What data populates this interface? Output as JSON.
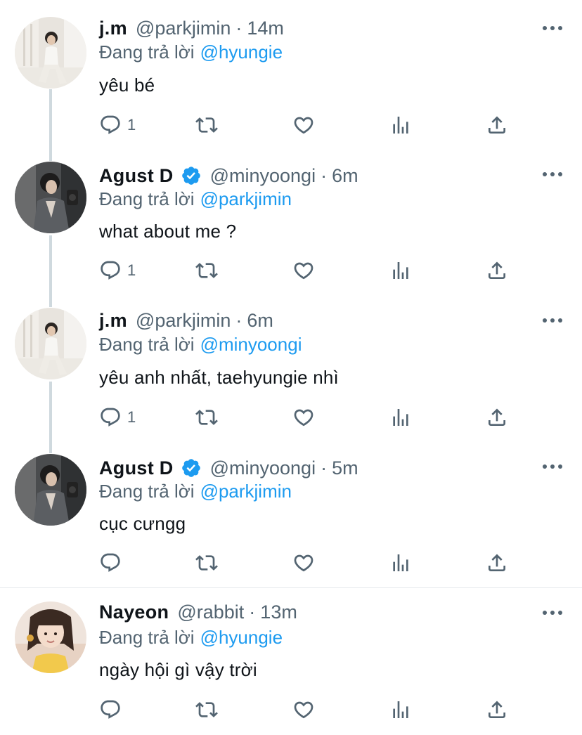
{
  "colors": {
    "link": "#1d9bf0",
    "muted": "#536471",
    "text": "#0f1419",
    "verified": "#1d9bf0",
    "thread_line": "#cfd9de"
  },
  "tweets": [
    {
      "name": "j.m",
      "handle": "@parkjimin",
      "dot": "·",
      "time": "14m",
      "replying_label": "Đang trả lời",
      "replying_to": "@hyungie",
      "text": "yêu bé",
      "reply_count": "1",
      "verified": false,
      "avatar": "jimin-photo"
    },
    {
      "name": "Agust D",
      "handle": "@minyoongi",
      "dot": "·",
      "time": "6m",
      "replying_label": "Đang trả lời",
      "replying_to": "@parkjimin",
      "text": "what about me ?",
      "reply_count": "1",
      "verified": true,
      "avatar": "yoongi-photo"
    },
    {
      "name": "j.m",
      "handle": "@parkjimin",
      "dot": "·",
      "time": "6m",
      "replying_label": "Đang trả lời",
      "replying_to": "@minyoongi",
      "text": "yêu anh nhất, taehyungie nhì",
      "reply_count": "1",
      "verified": false,
      "avatar": "jimin-photo"
    },
    {
      "name": "Agust D",
      "handle": "@minyoongi",
      "dot": "·",
      "time": "5m",
      "replying_label": "Đang trả lời",
      "replying_to": "@parkjimin",
      "text": "cục cưngg",
      "reply_count": "",
      "verified": true,
      "avatar": "yoongi-photo"
    },
    {
      "name": "Nayeon",
      "handle": "@rabbit",
      "dot": "·",
      "time": "13m",
      "replying_label": "Đang trả lời",
      "replying_to": "@hyungie",
      "text": "ngày hội gì vậy trời",
      "reply_count": "",
      "verified": false,
      "avatar": "nayeon-photo"
    }
  ],
  "icons": {
    "reply": "reply-icon",
    "retweet": "retweet-icon",
    "like": "heart-icon",
    "views": "views-icon",
    "share": "share-icon",
    "more": "more-icon"
  }
}
